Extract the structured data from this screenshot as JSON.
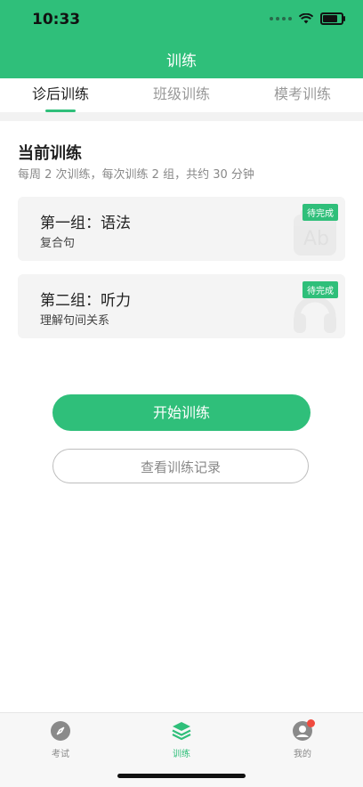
{
  "status_bar": {
    "time": "10:33"
  },
  "header": {
    "title": "训练"
  },
  "tabs": [
    {
      "label": "诊后训练",
      "active": true
    },
    {
      "label": "班级训练",
      "active": false
    },
    {
      "label": "模考训练",
      "active": false
    }
  ],
  "current_training": {
    "title": "当前训练",
    "subtitle": "每周 2 次训练，每次训练 2 组，共约 30 分钟"
  },
  "groups": [
    {
      "title": "第一组：语法",
      "subtitle": "复合句",
      "badge": "待完成",
      "icon": "ab-dictionary-icon"
    },
    {
      "title": "第二组：听力",
      "subtitle": "理解句间关系",
      "badge": "待完成",
      "icon": "headphones-icon"
    }
  ],
  "buttons": {
    "start": "开始训练",
    "history": "查看训练记录"
  },
  "bottom_nav": [
    {
      "label": "考试",
      "icon": "compass-icon"
    },
    {
      "label": "训练",
      "icon": "layers-icon",
      "active": true
    },
    {
      "label": "我的",
      "icon": "profile-icon",
      "has_notification": true
    }
  ],
  "colors": {
    "accent": "#2fbf7a",
    "badge_dot": "#f04a3e"
  }
}
